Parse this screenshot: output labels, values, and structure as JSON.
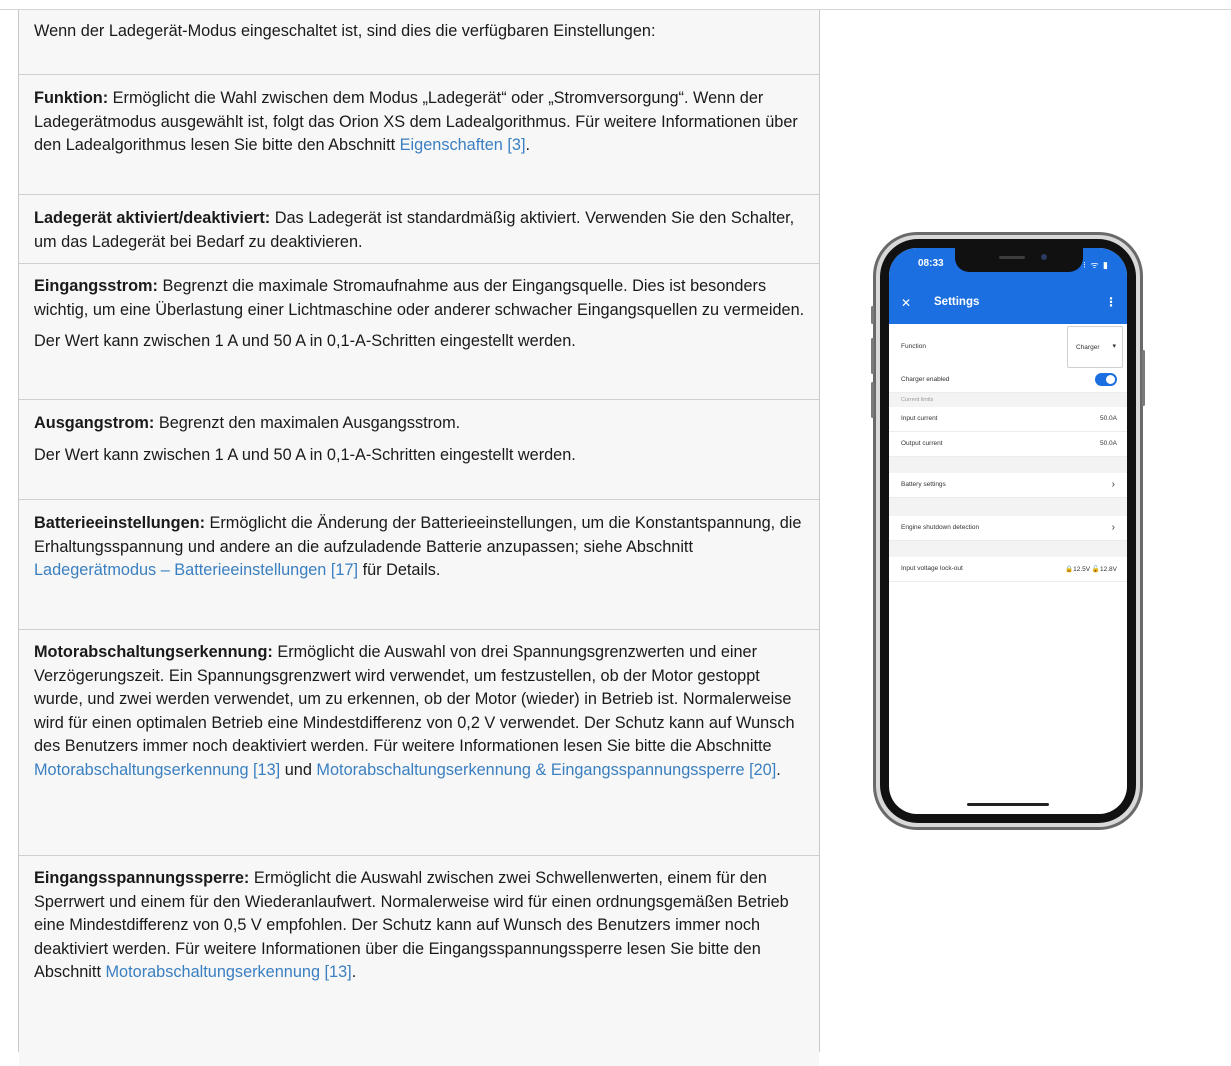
{
  "rows": [
    {
      "intro": "Wenn der Ladegerät-Modus eingeschaltet ist, sind dies die verfügbaren Einstellungen:"
    },
    {
      "bold": "Funktion:",
      "text": " Ermöglicht die Wahl zwischen dem Modus „Ladegerät“ oder „Stromversorgung“. Wenn der Ladegerätmodus ausgewählt ist, folgt das Orion XS dem Ladealgorithmus. Für weitere Informationen über den Ladealgorithmus lesen Sie bitte den Abschnitt ",
      "link": "Eigenschaften [3]",
      "after": "."
    },
    {
      "bold": "Ladegerät aktiviert/deaktiviert:",
      "text": " Das Ladegerät ist standardmäßig aktiviert. Verwenden Sie den Schalter, um das Ladegerät bei Bedarf zu deaktivieren."
    },
    {
      "bold": "Eingangsstrom:",
      "text": " Begrenzt die maximale Stromaufnahme aus der Eingangsquelle. Dies ist besonders wichtig, um eine Überlastung einer Lichtmaschine oder anderer schwacher Eingangsquellen zu vermeiden.",
      "note": "Der Wert kann zwischen 1 A und 50 A in 0,1-A-Schritten eingestellt werden."
    },
    {
      "bold": "Ausgangstrom:",
      "text": " Begrenzt den maximalen Ausgangsstrom.",
      "note": "Der Wert kann zwischen 1 A und 50 A in 0,1-A-Schritten eingestellt werden."
    },
    {
      "bold": "Batterieeinstellungen:",
      "text": " Ermöglicht die Änderung der Batterieeinstellungen, um die Konstantspannung, die Erhaltungsspannung und andere an die aufzuladende Batterie anzupassen; siehe Abschnitt ",
      "link": "Ladegerätmodus – Batterieeinstellungen [17]",
      "after": " für Details."
    },
    {
      "bold": "Motorabschaltungserkennung:",
      "text": " Ermöglicht die Auswahl von drei Spannungsgrenzwerten und einer Verzögerungszeit. Ein Spannungsgrenzwert wird verwendet, um festzustellen, ob der Motor gestoppt wurde, und zwei werden verwendet, um zu erkennen, ob der Motor (wieder) in Betrieb ist. Normalerweise wird für einen optimalen Betrieb eine Mindestdifferenz von 0,2 V verwendet. Der Schutz kann auf Wunsch des Benutzers immer noch deaktiviert werden. Für weitere Informationen lesen Sie bitte die Abschnitte ",
      "link": "Motorabschaltungserkennung [13]",
      "mid": " und ",
      "link2": "Motorabschaltungserkennung & Eingangsspannungssperre [20]",
      "after": "."
    },
    {
      "bold": "Eingangsspannungssperre:",
      "text": " Ermöglicht die Auswahl zwischen zwei Schwellenwerten, einem für den Sperrwert und einem für den Wiederanlaufwert. Normalerweise wird für einen ordnungsgemäßen Betrieb eine Mindestdifferenz von 0,5 V empfohlen. Der Schutz kann auf Wunsch des Benutzers immer noch deaktiviert werden. Für weitere Informationen über die Eingangsspannungssperre lesen Sie bitte den Abschnitt ",
      "link": "Motorabschaltungserkennung [13]",
      "after": "."
    }
  ],
  "phone": {
    "time": "08:33",
    "status_icons": "⁝ ᯤ ▮",
    "title": "Settings",
    "function_label": "Function",
    "function_value": "Charger",
    "charger_enabled_label": "Charger enabled",
    "charger_enabled": true,
    "section_current_limits": "Current limits",
    "input_current_label": "Input current",
    "input_current_value": "50.0A",
    "output_current_label": "Output current",
    "output_current_value": "50.0A",
    "battery_settings_label": "Battery settings",
    "engine_shutdown_label": "Engine shutdown detection",
    "input_lockout_label": "Input voltage lock-out",
    "input_lockout_value": "🔒12.5V 🔓12.8V"
  },
  "colors": {
    "link": "#3a7fc1",
    "app_blue": "#1b6fe0",
    "cell_bg": "#f7f7f7"
  }
}
